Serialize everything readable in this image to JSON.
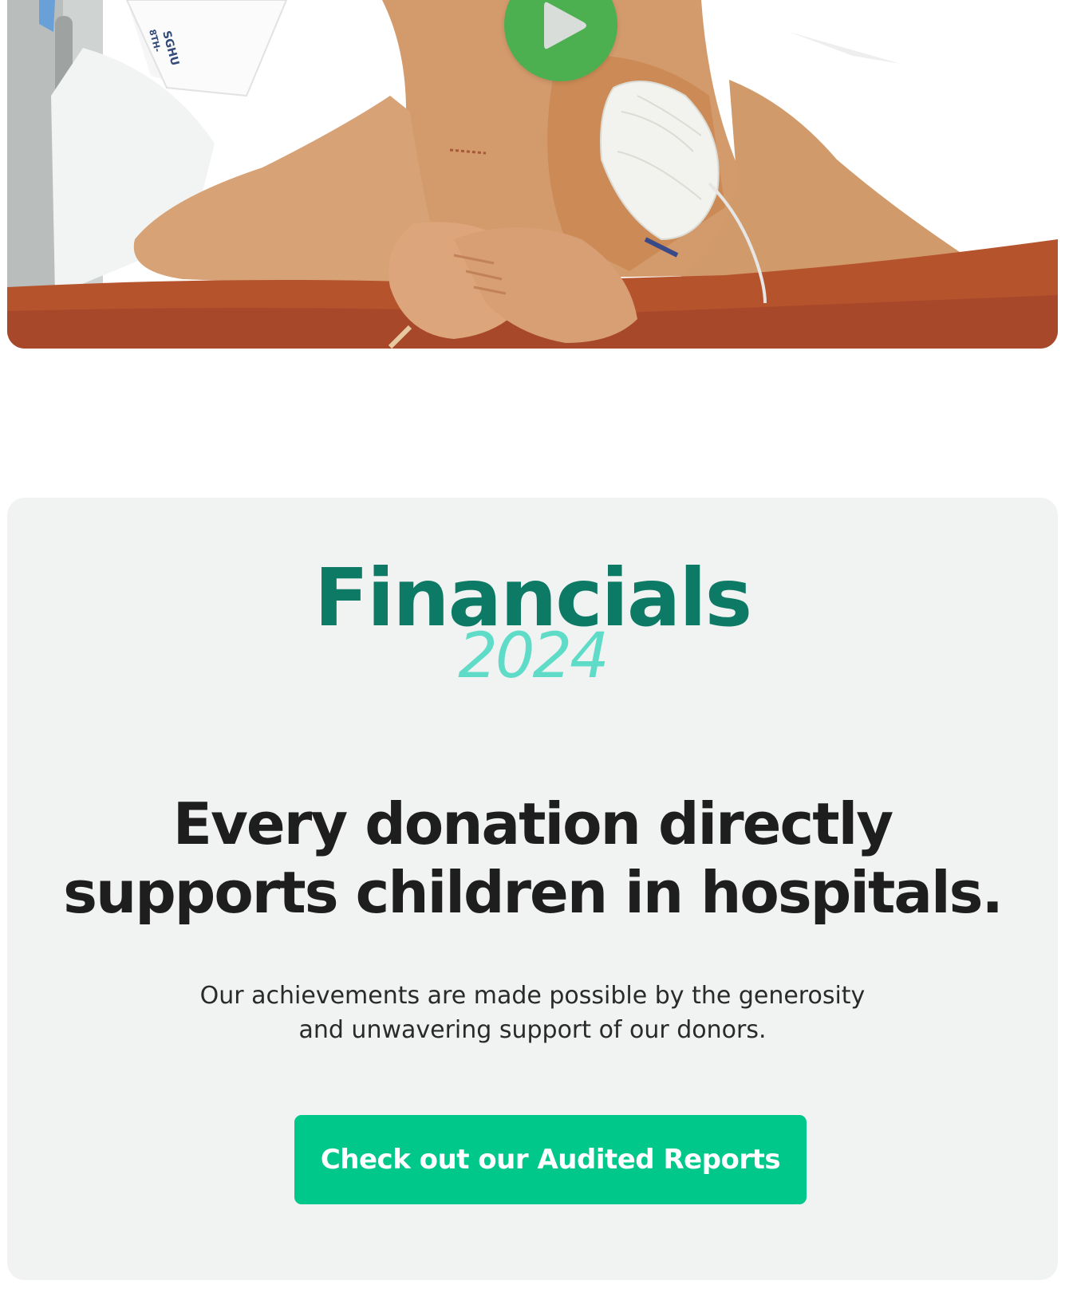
{
  "hero": {
    "play_button_label": "Play video",
    "bag_label_line1": "SGHU",
    "bag_label_line2": "8TH-",
    "colors": {
      "play": "#4caf50",
      "skin": "#d39a6c",
      "table": "#b5532c",
      "gauze": "#f2f2ee"
    }
  },
  "financials": {
    "title": "Financials",
    "year": "2024",
    "heading_line1": "Every donation directly",
    "heading_line2": "supports children in hospitals.",
    "description_line1": "Our achievements are made possible by the generosity",
    "description_line2": "and unwavering support of our donors.",
    "cta_label": "Check out our Audited Reports",
    "colors": {
      "title": "#0d7a65",
      "year": "#5fdcc8",
      "cta": "#00c78a",
      "card_bg": "#f1f2f2"
    }
  }
}
